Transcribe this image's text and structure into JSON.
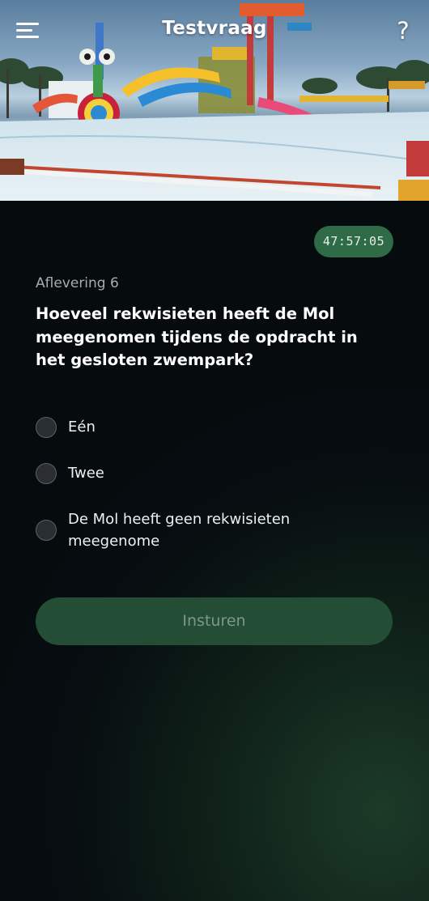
{
  "header": {
    "title": "Testvraag",
    "help_label": "?"
  },
  "hero": {
    "image": "water park with slides and pool"
  },
  "timer": {
    "value": "47:57:05"
  },
  "episode": "Aflevering 6",
  "question": "Hoeveel rekwisieten heeft de Mol meegenomen tijdens de opdracht in het gesloten zwempark?",
  "options": [
    {
      "label": "Eén",
      "selected": false
    },
    {
      "label": "Twee",
      "selected": false
    },
    {
      "label": "De Mol heeft geen rekwisieten meegenome",
      "selected": false
    }
  ],
  "submit": {
    "label": "Insturen",
    "enabled": false
  },
  "colors": {
    "timer_bg": "#2f6b47",
    "button_bg": "#234d35",
    "background": "#070d10"
  },
  "icons": {
    "menu": "hamburger-menu-icon",
    "help": "question-mark-icon"
  }
}
